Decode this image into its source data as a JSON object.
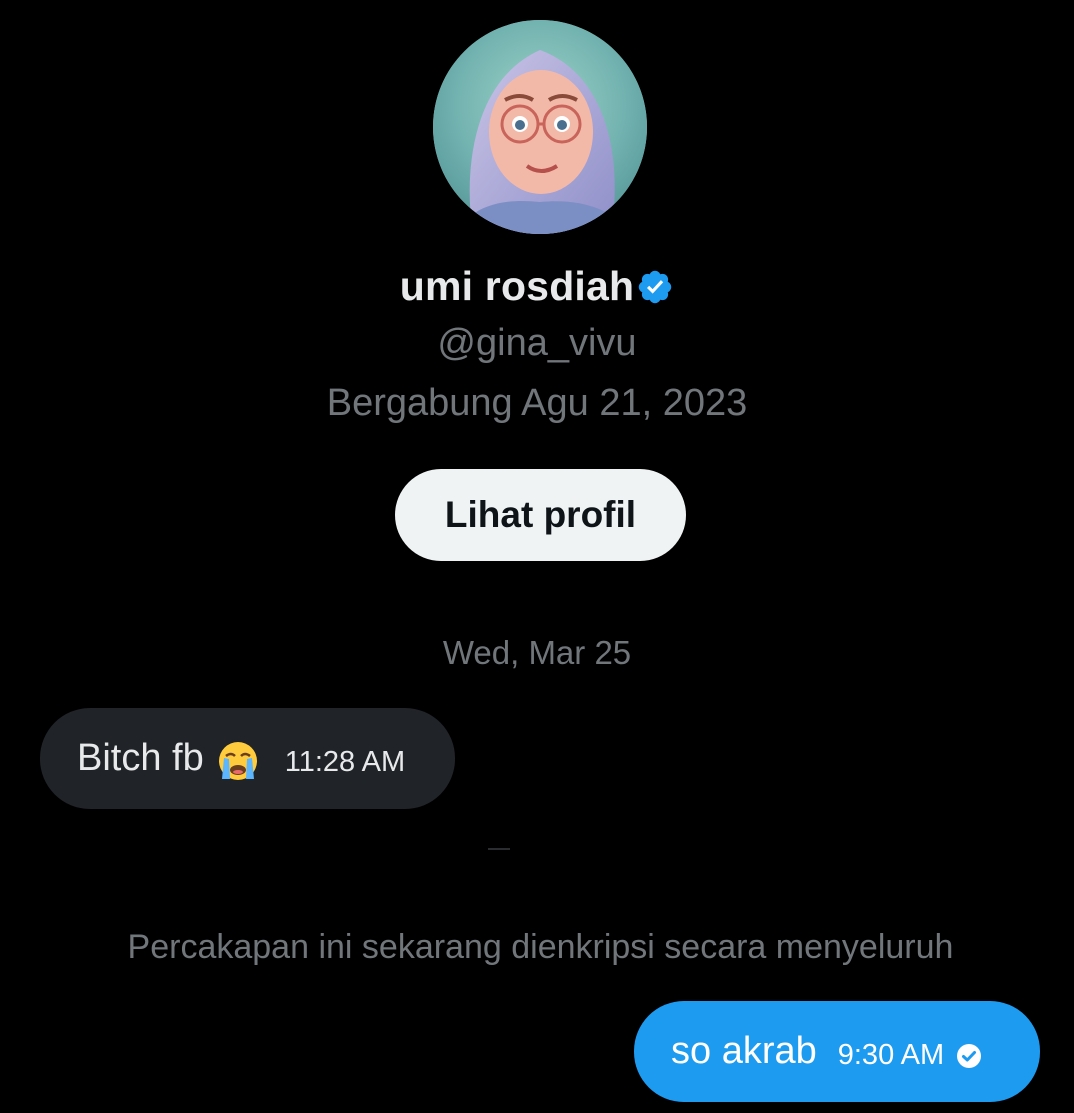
{
  "profile": {
    "name": "umi rosdiah",
    "handle": "@gina_vivu",
    "joined": "Bergabung Agu 21, 2023",
    "view_profile_label": "Lihat profil",
    "avatar_icon": "avatar-photo",
    "verified_icon": "verified-badge-icon"
  },
  "conversation": {
    "date_separator": "Wed, Mar 25",
    "messages": [
      {
        "direction": "incoming",
        "text": "Bitch fb",
        "emoji_icon": "loudly-crying-face-emoji",
        "time": "11:28 AM"
      },
      {
        "direction": "outgoing",
        "text": "so akrab",
        "time": "9:30 AM",
        "status_icon": "sent-check-icon"
      }
    ],
    "encryption_notice": "Percakapan ini sekarang dienkripsi secara menyeluruh"
  },
  "colors": {
    "background": "#000000",
    "primary_text": "#e7e9ea",
    "secondary_text": "#71767b",
    "accent": "#1d9bf0",
    "incoming_bubble": "#202327",
    "button_bg": "#eff3f4"
  }
}
